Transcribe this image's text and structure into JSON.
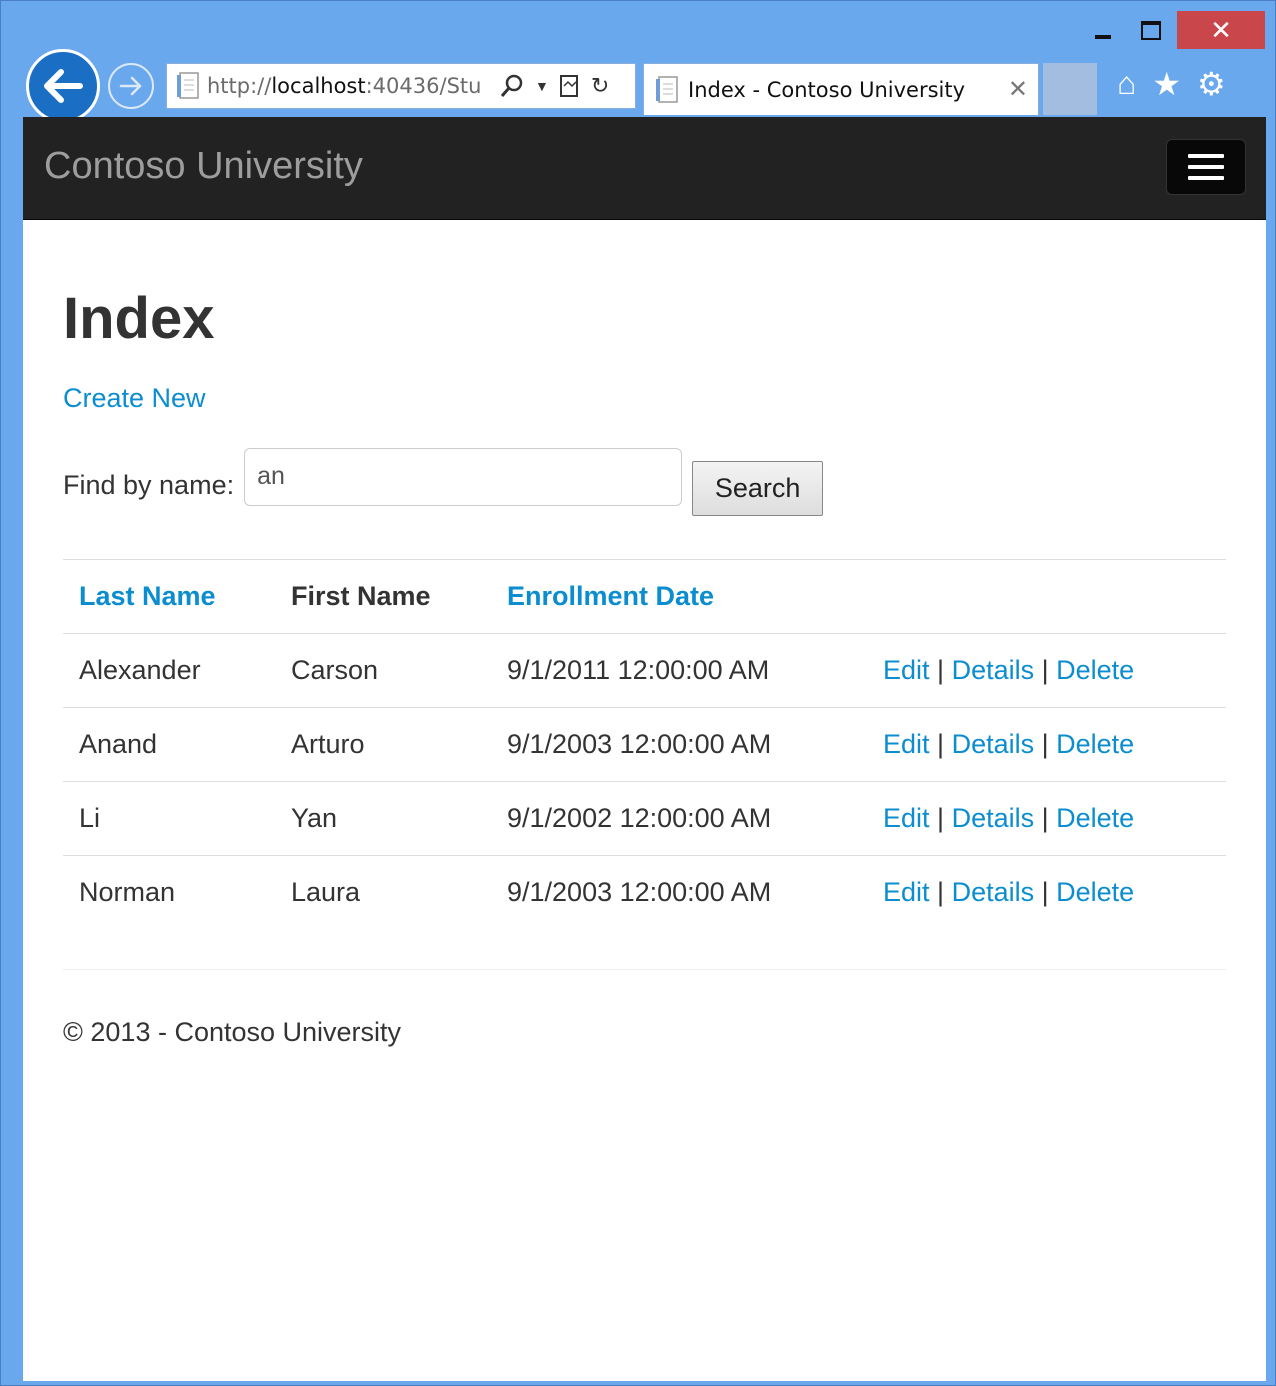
{
  "browser": {
    "url_prefix": "http://",
    "url_host": "localhost",
    "url_rest": ":40436/Stu",
    "tab_title": "Index - Contoso University"
  },
  "app": {
    "brand": "Contoso University"
  },
  "page": {
    "heading": "Index",
    "create_link": "Create New",
    "search": {
      "label": "Find by name:",
      "value": "an",
      "button": "Search"
    },
    "table": {
      "headers": [
        "Last Name",
        "First Name",
        "Enrollment Date"
      ],
      "rows": [
        {
          "last": "Alexander",
          "first": "Carson",
          "date": "9/1/2011 12:00:00 AM"
        },
        {
          "last": "Anand",
          "first": "Arturo",
          "date": "9/1/2003 12:00:00 AM"
        },
        {
          "last": "Li",
          "first": "Yan",
          "date": "9/1/2002 12:00:00 AM"
        },
        {
          "last": "Norman",
          "first": "Laura",
          "date": "9/1/2003 12:00:00 AM"
        }
      ],
      "actions": {
        "edit": "Edit",
        "details": "Details",
        "delete": "Delete",
        "separator": "|"
      }
    },
    "footer": "© 2013 - Contoso University"
  },
  "colors": {
    "link": "#0b8dcf",
    "navbar": "#222222",
    "window_frame": "#6aa8ee"
  }
}
